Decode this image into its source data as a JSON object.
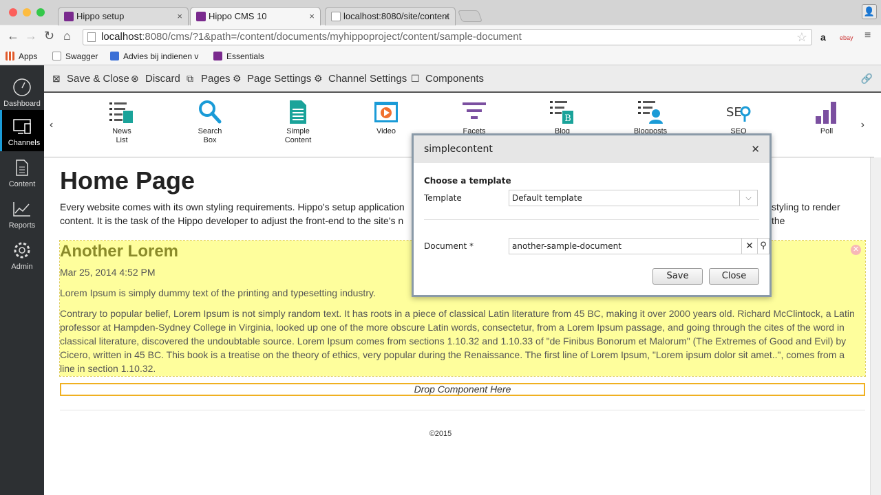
{
  "browser": {
    "tabs": [
      {
        "title": "Hippo setup",
        "close": "×"
      },
      {
        "title": "Hippo CMS 10",
        "close": "×"
      },
      {
        "title": "localhost:8080/site/content",
        "close": "×"
      }
    ],
    "address": {
      "host": "localhost",
      "path": ":8080/cms/?1&path=/content/documents/myhippoproject/content/sample-document"
    },
    "bookmarks": [
      {
        "label": "Apps",
        "color": "#e05a2b"
      },
      {
        "label": "Swagger",
        "color": "#ffffff"
      },
      {
        "label": "Advies bij indienen v",
        "color": "#3b6fd6"
      },
      {
        "label": "Essentials",
        "color": "#7a2a8e"
      }
    ],
    "extensions": [
      "a",
      "ebay",
      "≡"
    ]
  },
  "sidebar": {
    "items": [
      {
        "label": "Dashboard"
      },
      {
        "label": "Channels"
      },
      {
        "label": "Content"
      },
      {
        "label": "Reports"
      },
      {
        "label": "Admin"
      }
    ]
  },
  "cms_toolbar": {
    "save_close": "Save & Close",
    "discard": "Discard",
    "pages": "Pages",
    "page_settings": "Page Settings",
    "channel_settings": "Channel Settings",
    "components": "Components"
  },
  "catalog": {
    "items": [
      {
        "label1": "News",
        "label2": "List",
        "icon": "news-list-icon"
      },
      {
        "label1": "Search",
        "label2": "Box",
        "icon": "search-box-icon"
      },
      {
        "label1": "Simple",
        "label2": "Content",
        "icon": "simple-content-icon"
      },
      {
        "label1": "Video",
        "label2": "",
        "icon": "video-icon"
      },
      {
        "label1": "Facets",
        "label2": "",
        "icon": "facets-icon"
      },
      {
        "label1": "Blog",
        "label2": "",
        "icon": "blog-icon"
      },
      {
        "label1": "Blogposts",
        "label2": "",
        "icon": "blogposts-icon"
      },
      {
        "label1": "SEO",
        "label2": "",
        "icon": "seo-icon"
      },
      {
        "label1": "Poll",
        "label2": "",
        "icon": "poll-icon"
      }
    ],
    "prev": "‹",
    "next": "›"
  },
  "page": {
    "title": "Home Page",
    "intro": "Every website comes with its own styling requirements. Hippo's setup application styling to render the content. It is the task of the Hippo developer to adjust the front-end to the site's n",
    "intro_a": "Every website comes with its own styling requirements. Hippo's setup application",
    "intro_b": "styling to render the",
    "intro_c": "content. It is the task of the Hippo developer to adjust the front-end to the site's n",
    "article": {
      "title": "Another Lorem",
      "date": "Mar 25, 2014 4:52 PM",
      "p1": "Lorem Ipsum is simply dummy text of the printing and typesetting industry.",
      "p2": "Contrary to popular belief, Lorem Ipsum is not simply random text. It has roots in a piece of classical Latin literature from 45 BC, making it over 2000 years old. Richard McClintock, a Latin professor at Hampden-Sydney College in Virginia, looked up one of the more obscure Latin words, consectetur, from a Lorem Ipsum passage, and going through the cites of the word in classical literature, discovered the undoubtable source. Lorem Ipsum comes from sections 1.10.32 and 1.10.33 of \"de Finibus Bonorum et Malorum\" (The Extremes of Good and Evil) by Cicero, written in 45 BC. This book is a treatise on the theory of ethics, very popular during the Renaissance. The first line of Lorem Ipsum, \"Lorem ipsum dolor sit amet..\", comes from a line in section 1.10.32."
    },
    "drop_zone": "Drop Component Here",
    "footer": "©2015"
  },
  "dialog": {
    "title": "simplecontent",
    "section": "Choose a template",
    "template_label": "Template",
    "template_value": "Default template",
    "document_label": "Document *",
    "document_value": "another-sample-document",
    "save": "Save",
    "close": "Close"
  },
  "colors": {
    "accent": "#1a9bd7",
    "highlight": "#fefe9c",
    "drop_border": "#f0b020",
    "catalog_teal": "#1aa39a",
    "catalog_purple": "#7b4fa0"
  }
}
